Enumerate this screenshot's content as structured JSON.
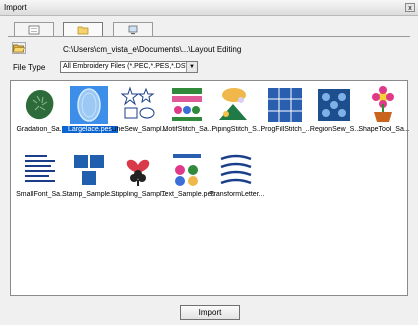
{
  "window": {
    "title": "Import",
    "close_glyph": "x"
  },
  "tabs": [
    {
      "icon": "view-list-icon"
    },
    {
      "icon": "folder-icon"
    },
    {
      "icon": "monitor-icon"
    }
  ],
  "path": "C:\\Users\\cm_vista_e\\Documents\\...\\Layout Editing",
  "filetype": {
    "label": "File Type",
    "value": "All Embroidery Files (*.PEC,*.PES,*.DST...)"
  },
  "files": [
    {
      "label": "Gradation_Sa..."
    },
    {
      "label": "Largelace.pes"
    },
    {
      "label": "LineSew_Sampl..."
    },
    {
      "label": "MotifStitch_Sa..."
    },
    {
      "label": "PipingStitch_S..."
    },
    {
      "label": "ProgFillStitch_..."
    },
    {
      "label": "RegionSew_S..."
    },
    {
      "label": "ShapeTool_Sa..."
    },
    {
      "label": "SmallFont_Sa..."
    },
    {
      "label": "Stamp_Sample...."
    },
    {
      "label": "Stippling_Sampl..."
    },
    {
      "label": "Text_Sample.pes"
    },
    {
      "label": "TransformLetter..."
    }
  ],
  "selected_index": 1,
  "buttons": {
    "import": "Import"
  },
  "colors": {
    "selection": "#0a64d2",
    "window_bg": "#f0f0f0",
    "pane_bg": "#ffffff"
  }
}
